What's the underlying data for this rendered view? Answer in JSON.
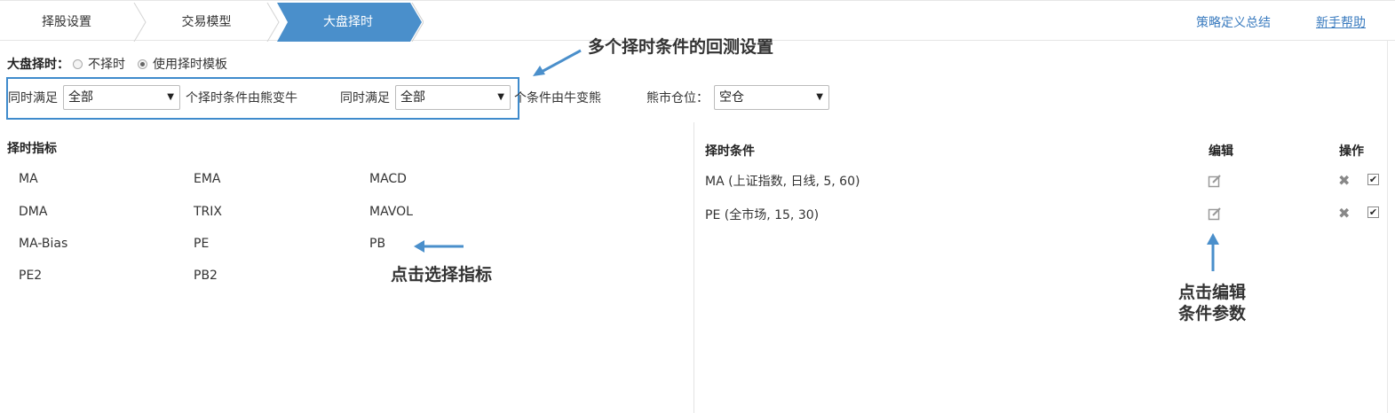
{
  "steps": [
    "择股设置",
    "交易模型",
    "大盘择时"
  ],
  "top_links": {
    "summary": "策略定义总结",
    "help": "新手帮助"
  },
  "timing": {
    "label": "大盘择时：",
    "options": [
      "不择时",
      "使用择时模板"
    ],
    "selected_index": 1
  },
  "conditions_row": {
    "meet1_label": "同时满足",
    "meet1_value": "全部",
    "meet1_suffix": "个择时条件由熊变牛",
    "meet2_label": "同时满足",
    "meet2_value": "全部",
    "meet2_suffix": "个条件由牛变熊",
    "bear_label": "熊市仓位：",
    "bear_value": "空仓"
  },
  "indicators": {
    "title": "择时指标",
    "items": [
      "MA",
      "EMA",
      "MACD",
      "DMA",
      "TRIX",
      "MAVOL",
      "MA-Bias",
      "PE",
      "PB",
      "PE2",
      "PB2"
    ]
  },
  "conditions_table": {
    "headers": {
      "condition": "择时条件",
      "edit": "编辑",
      "action": "操作"
    },
    "rows": [
      {
        "condition": "MA (上证指数, 日线, 5, 60)",
        "checked": true
      },
      {
        "condition": "PE (全市场, 15, 30)",
        "checked": true
      }
    ]
  },
  "annotations": {
    "multi": "多个择时条件的回测设置",
    "select": "点击选择指标",
    "edit_line1": "点击编辑",
    "edit_line2": "条件参数"
  },
  "colors": {
    "accent": "#4a8fcb",
    "link": "#3a7bbf",
    "highlight_box": "#3f8bcc"
  }
}
